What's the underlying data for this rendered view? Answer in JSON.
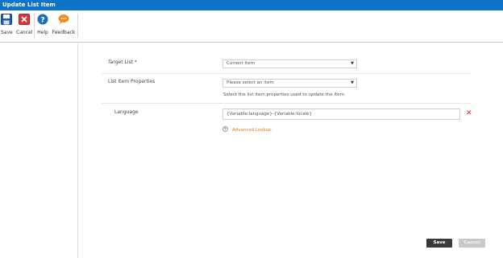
{
  "window": {
    "title": "Update List Item"
  },
  "ribbon": {
    "save_label": "Save",
    "cancel_label": "Cancel",
    "help_label": "Help",
    "feedback_label": "Feedback"
  },
  "form": {
    "target_list": {
      "label": "Target List",
      "required_mark": "*",
      "value": "Current Item"
    },
    "properties": {
      "label": "List Item Properties",
      "value": "Please select an item",
      "hint": "Select the list item properties used to update the item."
    },
    "language": {
      "label": "Language",
      "value": "{Variable:language}-{Variable:locale}"
    },
    "advanced_lookup": "Advanced Lookup"
  },
  "footer": {
    "save_label": "Save",
    "cancel_label": "Cancel"
  },
  "colors": {
    "titlebar": "#0f74c8",
    "accent": "#e07a10",
    "delete": "#d9252a"
  },
  "icons": [
    "save-icon",
    "cancel-icon",
    "help-icon",
    "feedback-icon",
    "delete-icon",
    "plus-icon",
    "caret-down-icon"
  ]
}
